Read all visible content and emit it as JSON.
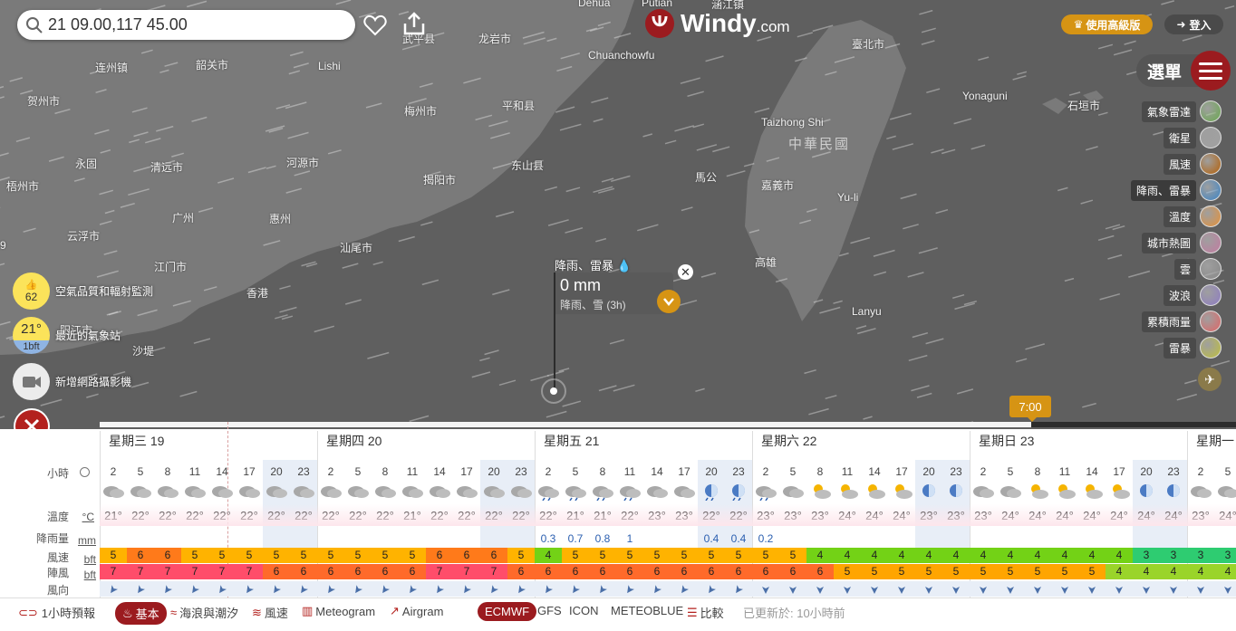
{
  "search": {
    "value": "21 09.00,117 45.00"
  },
  "logo": {
    "brand": "Windy",
    "suffix": ".com"
  },
  "top_right": {
    "premium_label": "使用高級版",
    "login_label": "登入",
    "menu_label": "選單"
  },
  "map_labels": {
    "country": "中華民國",
    "cities": [
      {
        "name": "Dehua"
      },
      {
        "name": "Putian"
      },
      {
        "name": "涵江镇"
      },
      {
        "name": "武平县"
      },
      {
        "name": "龙岩市"
      },
      {
        "name": "连州镇"
      },
      {
        "name": "韶关市"
      },
      {
        "name": "Lishi"
      },
      {
        "name": "Chuanchowfu"
      },
      {
        "name": "臺北市"
      },
      {
        "name": "贺州市"
      },
      {
        "name": "梅州市"
      },
      {
        "name": "平和县"
      },
      {
        "name": "Yonaguni"
      },
      {
        "name": "石垣市"
      },
      {
        "name": "Taizhong Shi"
      },
      {
        "name": "永固"
      },
      {
        "name": "清远市"
      },
      {
        "name": "河源市"
      },
      {
        "name": "东山县"
      },
      {
        "name": "揭阳市"
      },
      {
        "name": "梧州市"
      },
      {
        "name": "广州"
      },
      {
        "name": "惠州"
      },
      {
        "name": "馬公"
      },
      {
        "name": "嘉義市"
      },
      {
        "name": "Yu-li"
      },
      {
        "name": "云浮市"
      },
      {
        "name": "汕尾市"
      },
      {
        "name": "江门市"
      },
      {
        "name": "高雄"
      },
      {
        "name": "香港"
      },
      {
        "name": "Lanyu"
      },
      {
        "name": "阳江市"
      },
      {
        "name": "沙堤"
      },
      {
        "name": "9"
      }
    ]
  },
  "layers": [
    {
      "label": "氣象雷達",
      "color": "#6aa84f"
    },
    {
      "label": "衛星",
      "color": "#a0a0a0"
    },
    {
      "label": "風速",
      "color": "#b45f06"
    },
    {
      "label": "降雨、雷暴",
      "color": "#3d85c6"
    },
    {
      "label": "溫度",
      "color": "#e69138"
    },
    {
      "label": "城市熱圖",
      "color": "#c27ba0"
    },
    {
      "label": "雲",
      "color": "#888888"
    },
    {
      "label": "波浪",
      "color": "#8e7cc3"
    },
    {
      "label": "累積雨量",
      "color": "#e06666"
    },
    {
      "label": "雷暴",
      "color": "#bfbf3f"
    }
  ],
  "left_widgets": {
    "aq_value": "62",
    "aq_label": "空氣品質和輻射監測",
    "station_temp": "21°",
    "station_wind": "1bft",
    "station_label": "最近的氣象站",
    "webcam_label": "新增網路攝影機"
  },
  "popup": {
    "title": "降雨、雷暴",
    "value": "0 mm",
    "sub": "降雨、雪 (3h)"
  },
  "timeline": {
    "time_label": "7:00",
    "progress": 0.82
  },
  "forecast": {
    "days": [
      "星期三 19",
      "星期四 20",
      "星期五 21",
      "星期六 22",
      "星期日 23",
      "星期一"
    ],
    "row_labels": {
      "hours": "小時",
      "temp": "溫度",
      "temp_unit": "°C",
      "rain": "降雨量",
      "rain_unit": "mm",
      "wind": "風速",
      "wind_unit": "bft",
      "gust": "陣風",
      "gust_unit": "bft",
      "dir": "風向"
    },
    "hours": [
      "2",
      "5",
      "8",
      "11",
      "14",
      "17",
      "20",
      "23",
      "2",
      "5",
      "8",
      "11",
      "14",
      "17",
      "20",
      "23",
      "2",
      "5",
      "8",
      "11",
      "14",
      "17",
      "20",
      "23",
      "2",
      "5",
      "8",
      "11",
      "14",
      "17",
      "20",
      "23",
      "2",
      "5",
      "8",
      "11",
      "14",
      "17",
      "20",
      "23",
      "2",
      "5"
    ],
    "temps": [
      "21°",
      "22°",
      "22°",
      "22°",
      "22°",
      "22°",
      "22°",
      "22°",
      "22°",
      "22°",
      "22°",
      "21°",
      "22°",
      "22°",
      "22°",
      "22°",
      "22°",
      "21°",
      "21°",
      "22°",
      "23°",
      "23°",
      "22°",
      "22°",
      "23°",
      "23°",
      "23°",
      "24°",
      "24°",
      "24°",
      "23°",
      "23°",
      "23°",
      "24°",
      "24°",
      "24°",
      "24°",
      "24°",
      "24°",
      "24°",
      "23°",
      "24°"
    ],
    "rain": [
      "",
      "",
      "",
      "",
      "",
      "",
      "",
      "",
      "",
      "",
      "",
      "",
      "",
      "",
      "",
      "",
      "0.3",
      "0.7",
      "0.8",
      "1",
      "",
      "",
      "0.4",
      "0.4",
      "0.2",
      "",
      "",
      "",
      "",
      "",
      "",
      "",
      "",
      "",
      "",
      "",
      "",
      "",
      "",
      "",
      "",
      ""
    ],
    "wind": [
      "5",
      "6",
      "6",
      "5",
      "5",
      "5",
      "5",
      "5",
      "5",
      "5",
      "5",
      "5",
      "6",
      "6",
      "6",
      "5",
      "4",
      "5",
      "5",
      "5",
      "5",
      "5",
      "5",
      "5",
      "5",
      "5",
      "4",
      "4",
      "4",
      "4",
      "4",
      "4",
      "4",
      "4",
      "4",
      "4",
      "4",
      "4",
      "3",
      "3",
      "3",
      "3"
    ],
    "gust": [
      "7",
      "7",
      "7",
      "7",
      "7",
      "7",
      "6",
      "6",
      "6",
      "6",
      "6",
      "6",
      "7",
      "7",
      "7",
      "6",
      "6",
      "6",
      "6",
      "6",
      "6",
      "6",
      "6",
      "6",
      "6",
      "6",
      "6",
      "5",
      "5",
      "5",
      "5",
      "5",
      "5",
      "5",
      "5",
      "5",
      "5",
      "4",
      "4",
      "4",
      "4",
      "4"
    ]
  },
  "bottom": {
    "hourly_label": "1小時預報",
    "basic_label": "基本",
    "waves_label": "海浪與潮汐",
    "wind_label": "風速",
    "meteogram_label": "Meteogram",
    "airgram_label": "Airgram",
    "ecmwf_label": "ECMWF",
    "gfs_label": "GFS",
    "icon_label": "ICON",
    "meteoblue_label": "METEOBLUE",
    "compare_label": "比較",
    "updated_label": "已更新於: 10小時前"
  },
  "colors": {
    "accent": "#d69414",
    "brand_red": "#9b1b1f"
  }
}
